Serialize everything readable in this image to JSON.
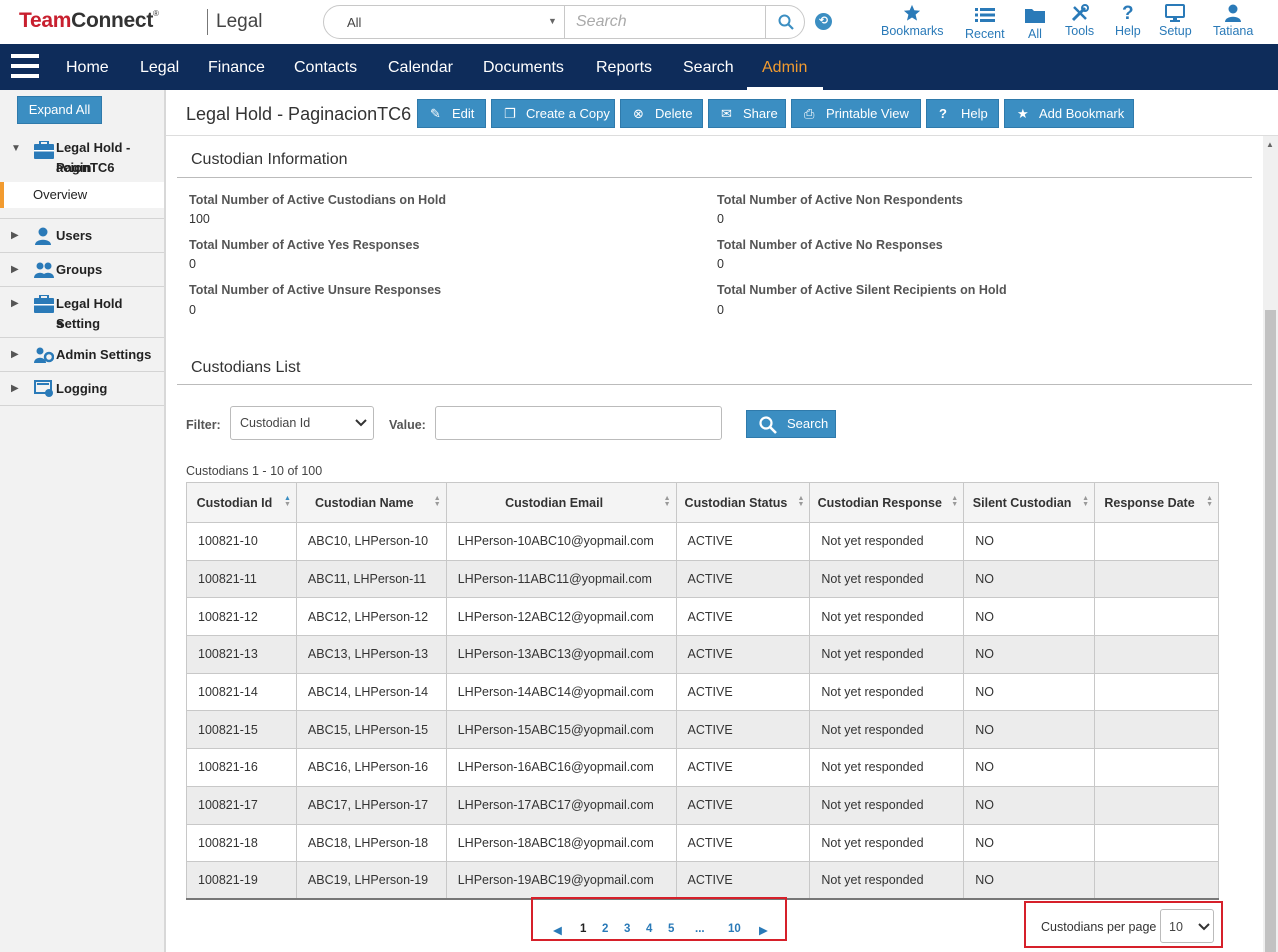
{
  "header": {
    "logo_brand_red": "Team",
    "logo_brand_dark": "Connect",
    "logo_reg": "®",
    "logo_product": "Legal",
    "search_scope": "All",
    "search_placeholder": "Search",
    "nav": [
      {
        "label": "Bookmarks",
        "icon": "star-icon"
      },
      {
        "label": "Recent",
        "icon": "list-icon"
      },
      {
        "label": "All",
        "icon": "folder-icon"
      },
      {
        "label": "Tools",
        "icon": "tools-icon"
      },
      {
        "label": "Help",
        "icon": "question-icon"
      },
      {
        "label": "Setup",
        "icon": "monitor-icon"
      },
      {
        "label": "Tatiana",
        "icon": "user-icon"
      }
    ]
  },
  "mainnav": {
    "items": [
      "Home",
      "Legal",
      "Finance",
      "Contacts",
      "Calendar",
      "Documents",
      "Reports",
      "Search",
      "Admin"
    ],
    "active": "Admin"
  },
  "sidebar": {
    "expand_all": "Expand All",
    "record_label_line1": "Legal Hold - Pagin",
    "record_label_line2": "acionTC6",
    "overview": "Overview",
    "sections": [
      {
        "label": "Users",
        "icon": "user-icon"
      },
      {
        "label": "Groups",
        "icon": "group-icon"
      },
      {
        "label_line1": "Legal Hold Setting",
        "label_line2": "s",
        "icon": "briefcase-icon"
      },
      {
        "label": "Admin Settings",
        "icon": "admin-gear-icon"
      },
      {
        "label": "Logging",
        "icon": "logging-icon"
      }
    ]
  },
  "page": {
    "title": "Legal Hold - PaginacionTC6",
    "toolbar": [
      "Edit",
      "Create a Copy",
      "Delete",
      "Share",
      "Printable View",
      "Help",
      "Add Bookmark"
    ]
  },
  "custodian_info": {
    "title": "Custodian Information",
    "fields": [
      {
        "label": "Total Number of Active Custodians on Hold",
        "value": "100"
      },
      {
        "label": "Total Number of Active Non Respondents",
        "value": "0"
      },
      {
        "label": "Total Number of Active Yes Responses",
        "value": "0"
      },
      {
        "label": "Total Number of Active No Responses",
        "value": "0"
      },
      {
        "label": "Total Number of Active Unsure Responses",
        "value": "0"
      },
      {
        "label": "Total Number of Active Silent Recipients on Hold",
        "value": "0"
      }
    ]
  },
  "custodians_list": {
    "title": "Custodians List",
    "filter_label": "Filter:",
    "filter_value": "Custodian Id",
    "value_label": "Value:",
    "value_input": "",
    "search_label": "Search",
    "count_text": "Custodians 1 - 10 of 100",
    "columns": [
      "Custodian Id",
      "Custodian Name",
      "Custodian Email",
      "Custodian Status",
      "Custodian Response",
      "Silent Custodian",
      "Response Date"
    ],
    "rows": [
      [
        "100821-10",
        "ABC10, LHPerson-10",
        "LHPerson-10ABC10@yopmail.com",
        "ACTIVE",
        "Not yet responded",
        "NO",
        ""
      ],
      [
        "100821-11",
        "ABC11, LHPerson-11",
        "LHPerson-11ABC11@yopmail.com",
        "ACTIVE",
        "Not yet responded",
        "NO",
        ""
      ],
      [
        "100821-12",
        "ABC12, LHPerson-12",
        "LHPerson-12ABC12@yopmail.com",
        "ACTIVE",
        "Not yet responded",
        "NO",
        ""
      ],
      [
        "100821-13",
        "ABC13, LHPerson-13",
        "LHPerson-13ABC13@yopmail.com",
        "ACTIVE",
        "Not yet responded",
        "NO",
        ""
      ],
      [
        "100821-14",
        "ABC14, LHPerson-14",
        "LHPerson-14ABC14@yopmail.com",
        "ACTIVE",
        "Not yet responded",
        "NO",
        ""
      ],
      [
        "100821-15",
        "ABC15, LHPerson-15",
        "LHPerson-15ABC15@yopmail.com",
        "ACTIVE",
        "Not yet responded",
        "NO",
        ""
      ],
      [
        "100821-16",
        "ABC16, LHPerson-16",
        "LHPerson-16ABC16@yopmail.com",
        "ACTIVE",
        "Not yet responded",
        "NO",
        ""
      ],
      [
        "100821-17",
        "ABC17, LHPerson-17",
        "LHPerson-17ABC17@yopmail.com",
        "ACTIVE",
        "Not yet responded",
        "NO",
        ""
      ],
      [
        "100821-18",
        "ABC18, LHPerson-18",
        "LHPerson-18ABC18@yopmail.com",
        "ACTIVE",
        "Not yet responded",
        "NO",
        ""
      ],
      [
        "100821-19",
        "ABC19, LHPerson-19",
        "LHPerson-19ABC19@yopmail.com",
        "ACTIVE",
        "Not yet responded",
        "NO",
        ""
      ]
    ],
    "pager": {
      "prev": "◀",
      "pages": [
        "1",
        "2",
        "3",
        "4",
        "5",
        "...",
        "10"
      ],
      "current": "1",
      "next": "▶"
    },
    "per_page_label": "Custodians per page",
    "per_page_value": "10"
  },
  "colors": {
    "nav_bg": "#0e2c5a",
    "accent": "#3b8ec2",
    "active_tab": "#f29b2f",
    "highlight_border": "#d6202a"
  }
}
